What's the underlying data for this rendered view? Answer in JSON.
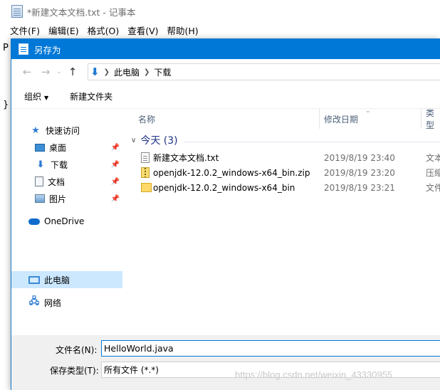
{
  "notepad": {
    "title": "*新建文本文档.txt - 记事本",
    "menus": [
      "文件(F)",
      "编辑(E)",
      "格式(O)",
      "查看(V)",
      "帮助(H)"
    ],
    "visible_text": [
      "P",
      "}"
    ]
  },
  "dialog": {
    "title": "另存为",
    "nav": {
      "back": "←",
      "forward": "→",
      "dropdown": "⌄",
      "up": "↑"
    },
    "address": {
      "crumbs": [
        "此电脑",
        "下载"
      ]
    },
    "toolbar": {
      "organize": "组织",
      "new_folder": "新建文件夹"
    },
    "tree": [
      {
        "label": "快速访问",
        "icon": "star-icon",
        "pinned": false
      },
      {
        "label": "桌面",
        "icon": "desktop-icon",
        "pinned": true
      },
      {
        "label": "下载",
        "icon": "download-icon",
        "pinned": true
      },
      {
        "label": "文档",
        "icon": "documents-icon",
        "pinned": true
      },
      {
        "label": "图片",
        "icon": "pictures-icon",
        "pinned": true
      },
      {
        "label": "OneDrive",
        "icon": "onedrive-icon",
        "pinned": false
      },
      {
        "label": "此电脑",
        "icon": "pc-icon",
        "pinned": false,
        "selected": true
      },
      {
        "label": "网络",
        "icon": "network-icon",
        "pinned": false
      }
    ],
    "columns": {
      "name": "名称",
      "date": "修改日期",
      "type": "类型"
    },
    "group": {
      "label": "今天 (3)"
    },
    "files": [
      {
        "name": "新建文本文档.txt",
        "date": "2019/8/19 23:40",
        "type": "文本",
        "icon": "text-file-icon"
      },
      {
        "name": "openjdk-12.0.2_windows-x64_bin.zip",
        "date": "2019/8/19 23:20",
        "type": "压缩",
        "icon": "zip-file-icon"
      },
      {
        "name": "openjdk-12.0.2_windows-x64_bin",
        "date": "2019/8/19 23:21",
        "type": "文件",
        "icon": "folder-icon"
      }
    ],
    "filename": {
      "label": "文件名(N):",
      "value": "HelloWorld.java"
    },
    "savetype": {
      "label": "保存类型(T):",
      "value": "所有文件  (*.*)"
    }
  },
  "watermark": "https://blog.csdn.net/weixin_43330955"
}
